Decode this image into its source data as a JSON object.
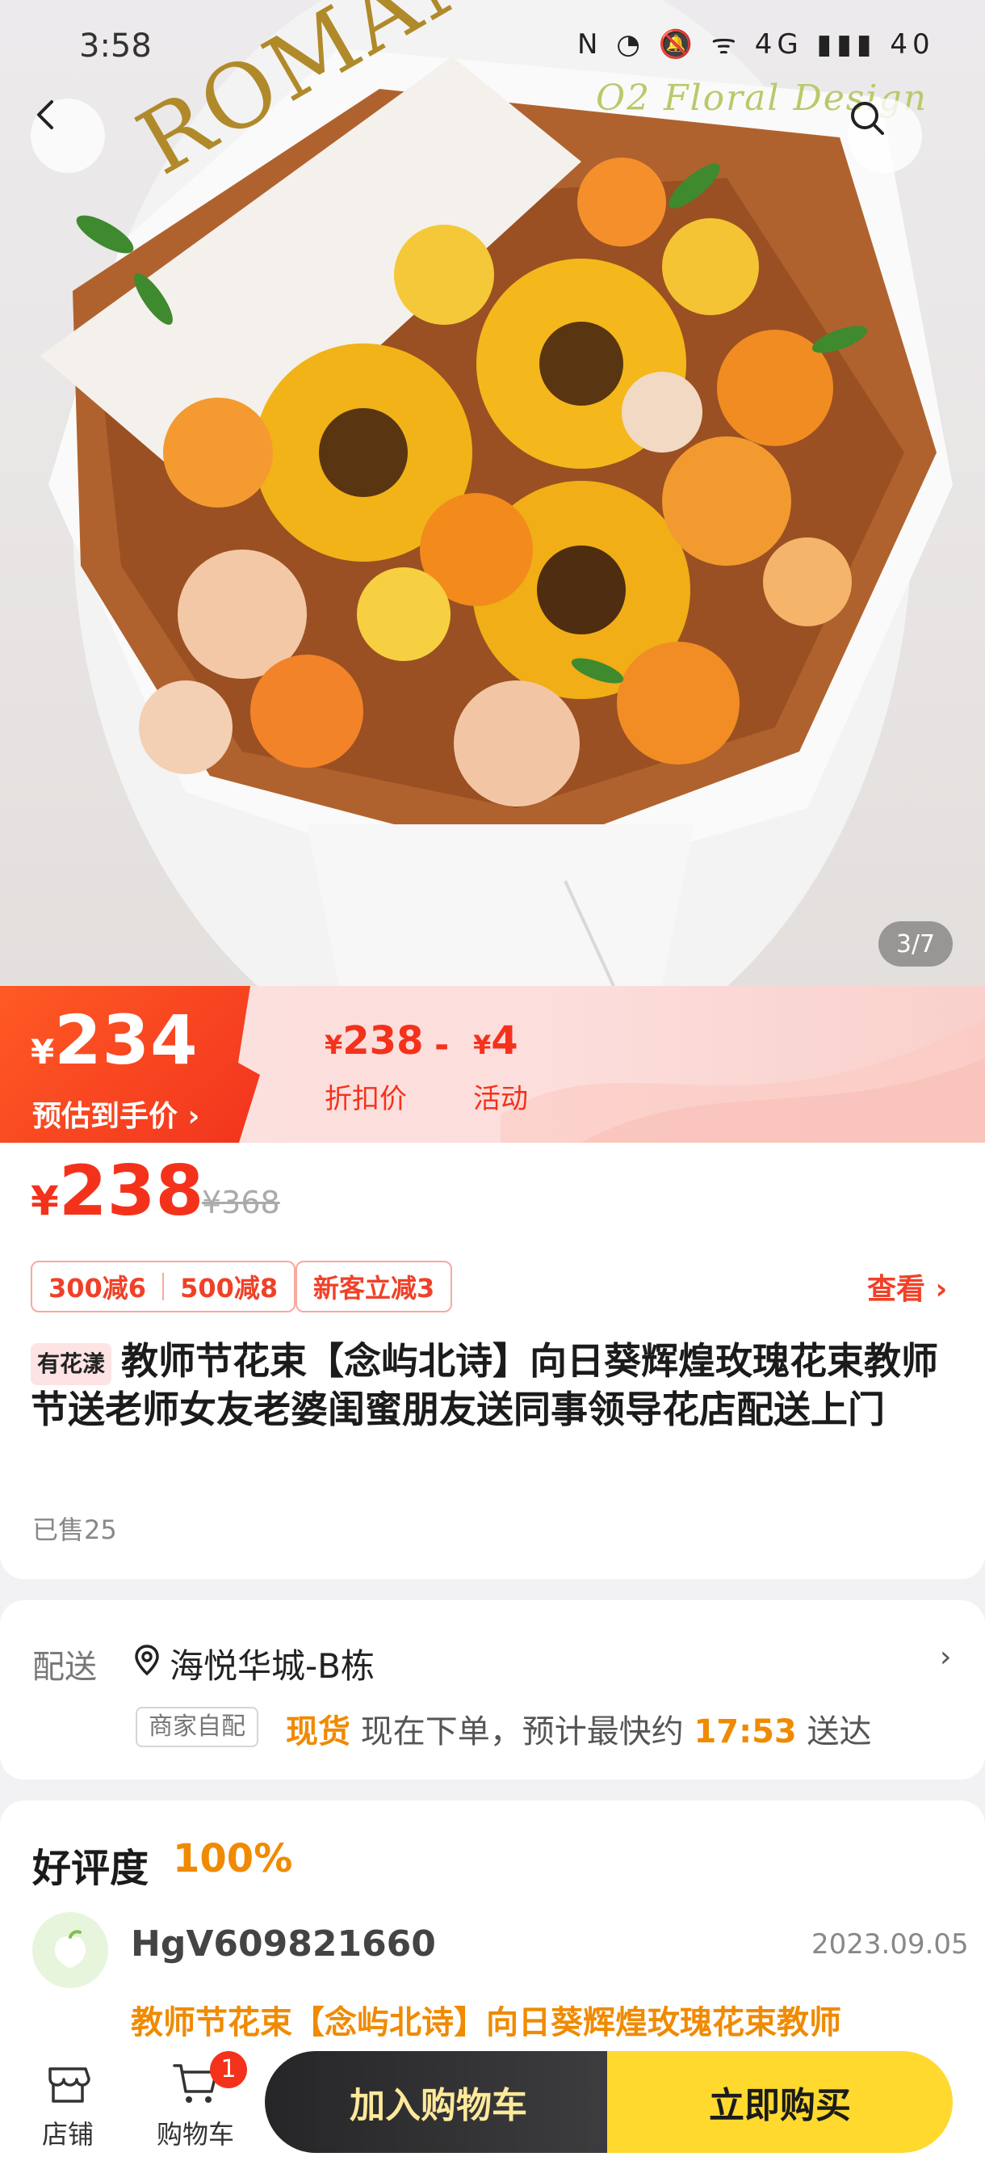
{
  "status_bar": {
    "time": "3:58",
    "icons": "N ◔ 🔕 ᯤ 4G ▮▮▮ 40"
  },
  "hero": {
    "watermark": "O2 Floral Design",
    "image_counter": "3/7",
    "wrap_text": "ROMANTIC"
  },
  "price_banner": {
    "estimated_currency": "¥",
    "estimated_price": "234",
    "estimated_label": "预估到手价 ›",
    "discount_currency": "¥",
    "discount_value": "238",
    "discount_label": "折扣价",
    "minus": "-",
    "promo_currency": "¥",
    "promo_value": "4",
    "promo_label": "活动"
  },
  "product": {
    "currency": "¥",
    "price": "238",
    "original_price": "¥368",
    "coupons": [
      {
        "parts": [
          "300减6",
          "500减8"
        ]
      },
      {
        "parts": [
          "新客立减3"
        ]
      }
    ],
    "see_label": "查看 ›",
    "shop_tag": "有花漾",
    "title": "教师节花束【念屿北诗】向日葵辉煌玫瑰花束教师节送老师女友老婆闺蜜朋友送同事领导花店配送上门",
    "sold": "已售25"
  },
  "delivery": {
    "label": "配送",
    "address": "海悦华城-B栋",
    "arrow": "›",
    "self_tag": "商家自配",
    "stock": "现货",
    "info_prefix": "现在下单，预计最快约",
    "time": "17:53",
    "info_suffix": "送达"
  },
  "reviews": {
    "title": "好评度",
    "rate": "100%",
    "user": "HgV609821660",
    "date": "2023.09.05",
    "snippet": "教师节花束【念屿北诗】向日葵辉煌玫瑰花束教师"
  },
  "bottom_bar": {
    "store_label": "店铺",
    "cart_label": "购物车",
    "cart_badge": "1",
    "add_to_cart": "加入购物车",
    "buy_now": "立即购买"
  },
  "colors": {
    "accent_red": "#f4321c",
    "accent_orange": "#f08a00",
    "buy_yellow": "#ffd92e",
    "cart_dark": "#2e2e30"
  },
  "icons": [
    "back-icon",
    "search-icon",
    "location-pin-icon",
    "store-icon",
    "cart-icon",
    "chevron-right-icon"
  ]
}
